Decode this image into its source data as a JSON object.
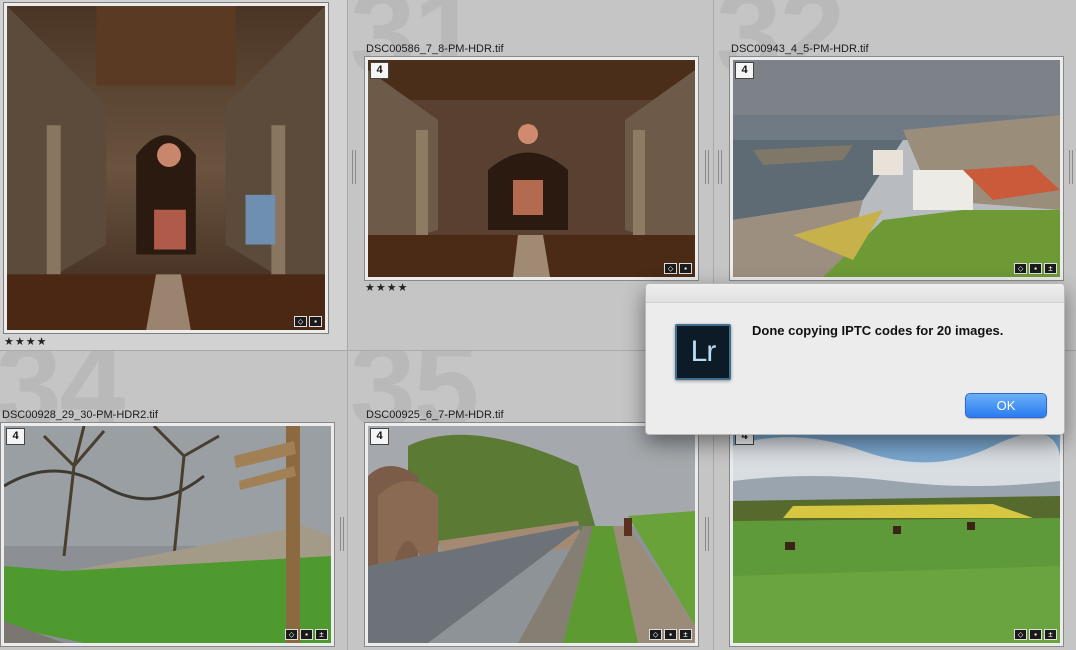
{
  "grid": {
    "cells": [
      {
        "index": "",
        "filename": "",
        "badge": "",
        "stars": "★★★★"
      },
      {
        "index": "31",
        "filename": "DSC00586_7_8-PM-HDR.tif",
        "badge": "4",
        "stars": "★★★★"
      },
      {
        "index": "32",
        "filename": "DSC00943_4_5-PM-HDR.tif",
        "badge": "4",
        "stars": ""
      },
      {
        "index": "34",
        "filename": "DSC00928_29_30-PM-HDR2.tif",
        "badge": "4",
        "stars": ""
      },
      {
        "index": "35",
        "filename": "DSC00925_6_7-PM-HDR.tif",
        "badge": "4",
        "stars": ""
      },
      {
        "index": "",
        "filename": "",
        "badge": "4",
        "stars": ""
      }
    ]
  },
  "dialog": {
    "app_icon_text": "Lr",
    "message": "Done copying IPTC codes for 20 images.",
    "ok_label": "OK"
  },
  "colors": {
    "cell_background": "#c5c5c5",
    "dialog_background": "#ececec",
    "ok_button": "#2a7bf0",
    "lr_icon_bg": "#0c1b26",
    "lr_icon_text": "#b8dcf2"
  },
  "icons": [
    "keyword-tag-icon",
    "comment-icon",
    "develop-adjusted-icon"
  ]
}
